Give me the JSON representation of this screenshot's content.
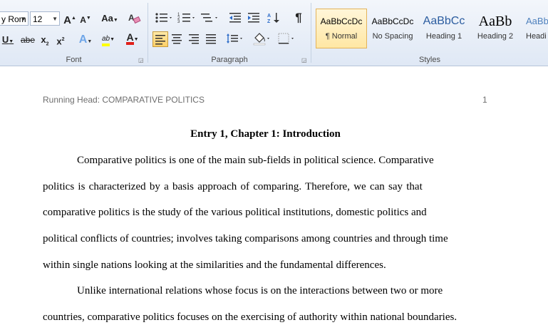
{
  "ribbon": {
    "font_group": {
      "label": "Font",
      "font_name": "y Rom",
      "font_size": "12",
      "grow_font": "A",
      "shrink_font": "A",
      "change_case": "Aa",
      "underline": "U",
      "strikethrough": "abe",
      "subscript": "x",
      "superscript": "x",
      "text_effects": "A",
      "highlight": "ab",
      "font_color": "A",
      "font_color_value": "#e0201a",
      "highlight_color_value": "#ffff00"
    },
    "paragraph_group": {
      "label": "Paragraph",
      "show_marks": "¶"
    },
    "styles_group": {
      "label": "Styles",
      "items": [
        {
          "sample": "AaBbCcDc",
          "name": "¶ Normal",
          "active": true
        },
        {
          "sample": "AaBbCcDc",
          "name": "No Spacing",
          "active": false
        },
        {
          "sample": "AaBbCc",
          "name": "Heading 1",
          "active": false
        },
        {
          "sample": "AaBb",
          "name": "Heading 2",
          "active": false
        },
        {
          "sample": "AaBbC",
          "name": "Headi",
          "active": false
        }
      ]
    }
  },
  "document": {
    "running_head": "Running Head: COMPARATIVE POLITICS",
    "page_number": "1",
    "title": "Entry 1, Chapter 1: Introduction",
    "lines": [
      {
        "text": "Comparative politics is one of the main sub-fields in political  science. Comparative",
        "indent": true
      },
      {
        "text": "politics  is  characterized by a basis approach of comparing.  Therefore,  we can say that",
        "indent": false
      },
      {
        "text": "comparative politics  is the study of the various political institutions, domestic politics and",
        "indent": false
      },
      {
        "text": "political conflicts of countries; involves taking comparisons  among countries and through time",
        "indent": false
      },
      {
        "text": "within single nations looking  at the similarities  and the fundamental differences.",
        "indent": false
      },
      {
        "text": "Unlike international relations  whose focus is  on the interactions between two or more",
        "indent": true
      },
      {
        "text": "countries,  comparative politics  focuses on the exercising of authority within national boundaries.",
        "indent": false
      }
    ]
  }
}
